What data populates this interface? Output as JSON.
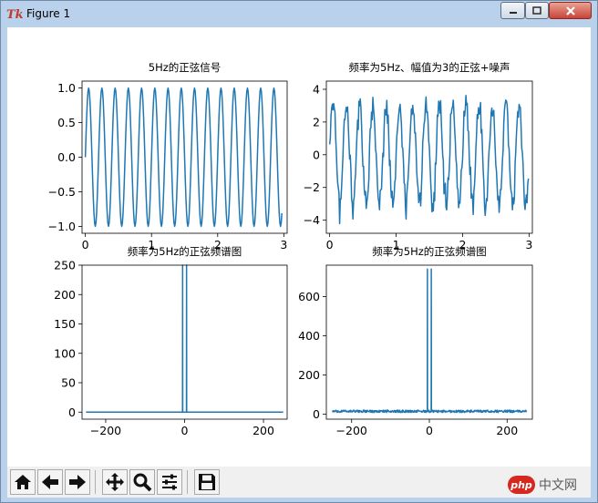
{
  "window": {
    "title": "Figure 1"
  },
  "watermark": {
    "logo": "php",
    "text": "中文网"
  },
  "toolbar": {
    "buttons": [
      {
        "name": "home-icon"
      },
      {
        "name": "back-arrow-icon"
      },
      {
        "name": "forward-arrow-icon"
      },
      {
        "name": "pan-icon"
      },
      {
        "name": "zoom-icon"
      },
      {
        "name": "subplots-icon"
      },
      {
        "name": "save-icon"
      }
    ]
  },
  "colors": {
    "line": "#1f77b4",
    "axis": "#000000"
  },
  "chart_data": [
    {
      "type": "line",
      "title": "5Hz的正弦信号",
      "xlim": [
        -0.05,
        3.05
      ],
      "ylim": [
        -1.1,
        1.1
      ],
      "xticks": [
        0,
        1,
        2,
        3
      ],
      "xticklabels": [
        "0",
        "1",
        "2",
        "3"
      ],
      "yticks": [
        1.0,
        0.5,
        0.0,
        -0.5,
        -1.0
      ],
      "yticklabels": [
        "1.0",
        "0.5",
        "0.0",
        "−0.5",
        "−1.0"
      ],
      "series": [
        {
          "function": "sin",
          "frequency_hz": 5,
          "amplitude": 1,
          "x_start": 0,
          "x_end": 2.97,
          "sample_rate": 100
        }
      ]
    },
    {
      "type": "line",
      "title": "频率为5Hz、幅值为3的正弦+噪声",
      "xlim": [
        -0.05,
        3.05
      ],
      "ylim": [
        -4.8,
        4.5
      ],
      "xticks": [
        0,
        1,
        2,
        3
      ],
      "xticklabels": [
        "0",
        "1",
        "2",
        "3"
      ],
      "yticks": [
        4,
        2,
        0,
        -2,
        -4
      ],
      "yticklabels": [
        "4",
        "2",
        "0",
        "−2",
        "−4"
      ],
      "series": [
        {
          "function": "sin+noise",
          "frequency_hz": 5,
          "amplitude": 3,
          "noise_amplitude": 1,
          "x_start": 0,
          "x_end": 2.99,
          "sample_rate": 100
        }
      ]
    },
    {
      "type": "line",
      "title": "频率为5Hz的正弦频谱图",
      "xlim": [
        -260,
        260
      ],
      "ylim": [
        -12,
        250
      ],
      "xticks": [
        -200,
        0,
        200
      ],
      "xticklabels": [
        "−200",
        "0",
        "200"
      ],
      "yticks": [
        250,
        200,
        150,
        100,
        50,
        0
      ],
      "yticklabels": [
        "250",
        "200",
        "150",
        "100",
        "50",
        "0"
      ],
      "series": [
        {
          "spectrum": true,
          "x_start": -250,
          "x_end": 250,
          "baseline": 0,
          "baseline_noise": 0,
          "peaks": [
            {
              "x": -5,
              "y": 250
            },
            {
              "x": 5,
              "y": 250
            }
          ]
        }
      ]
    },
    {
      "type": "line",
      "title": "频率为5Hz的正弦频谱图",
      "xlim": [
        -265,
        265
      ],
      "ylim": [
        -25,
        760
      ],
      "xticks": [
        -200,
        0,
        200
      ],
      "xticklabels": [
        "−200",
        "0",
        "200"
      ],
      "yticks": [
        600,
        400,
        200,
        0
      ],
      "yticklabels": [
        "600",
        "400",
        "200",
        "0"
      ],
      "series": [
        {
          "spectrum": true,
          "x_start": -250,
          "x_end": 250,
          "baseline": 15,
          "baseline_noise": 12,
          "peaks": [
            {
              "x": -5,
              "y": 740
            },
            {
              "x": 5,
              "y": 740
            }
          ]
        }
      ]
    }
  ]
}
